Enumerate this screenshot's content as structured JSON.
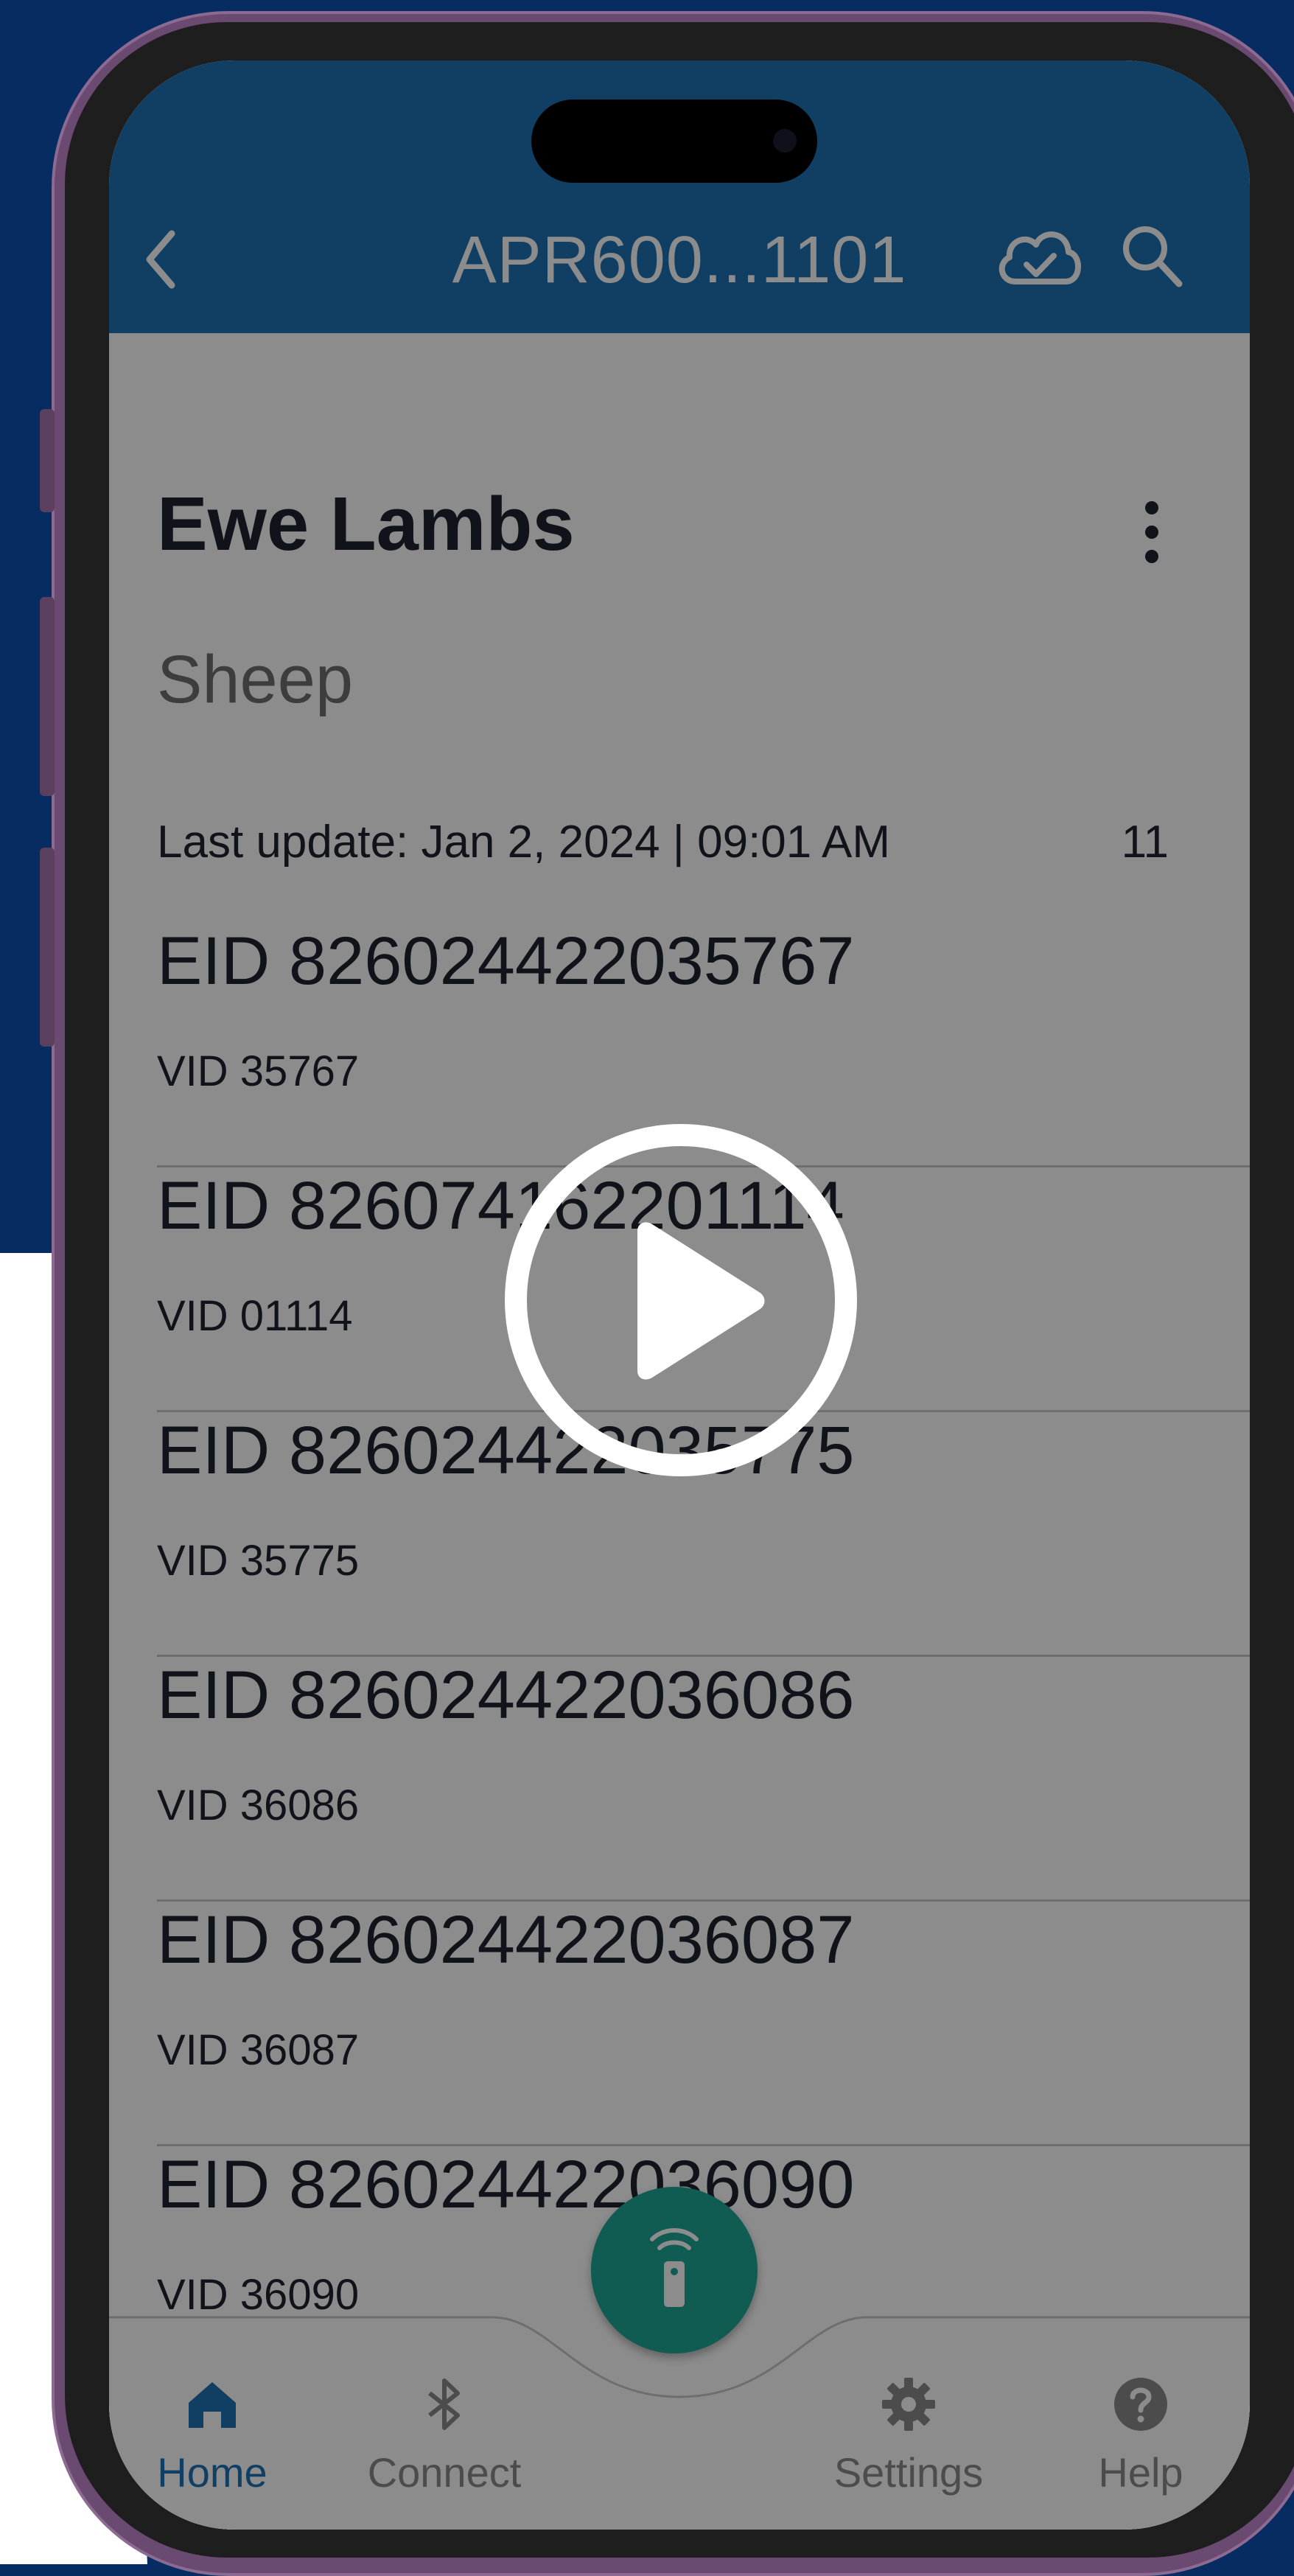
{
  "app": {
    "title": "APR600...1101"
  },
  "group": {
    "name": "Ewe Lambs",
    "species": "Sheep",
    "last_update": "Last update: Jan 2, 2024 | 09:01 AM",
    "count": "11"
  },
  "animals": [
    {
      "eid": "EID 826024422035767",
      "vid": "VID 35767"
    },
    {
      "eid": "EID 826074162201114",
      "vid": "VID 01114"
    },
    {
      "eid": "EID 826024422035775",
      "vid": "VID 35775"
    },
    {
      "eid": "EID 826024422036086",
      "vid": "VID 36086"
    },
    {
      "eid": "EID 826024422036087",
      "vid": "VID 36087"
    },
    {
      "eid": "EID 826024422036090",
      "vid": "VID 36090"
    }
  ],
  "peek_text": "2035",
  "nav": {
    "home": "Home",
    "connect": "Connect",
    "settings": "Settings",
    "help": "Help"
  },
  "colors": {
    "background": "#062c62",
    "appbar": "#1f73b7",
    "fab": "#1fa896",
    "active_nav": "#1f73b7"
  }
}
